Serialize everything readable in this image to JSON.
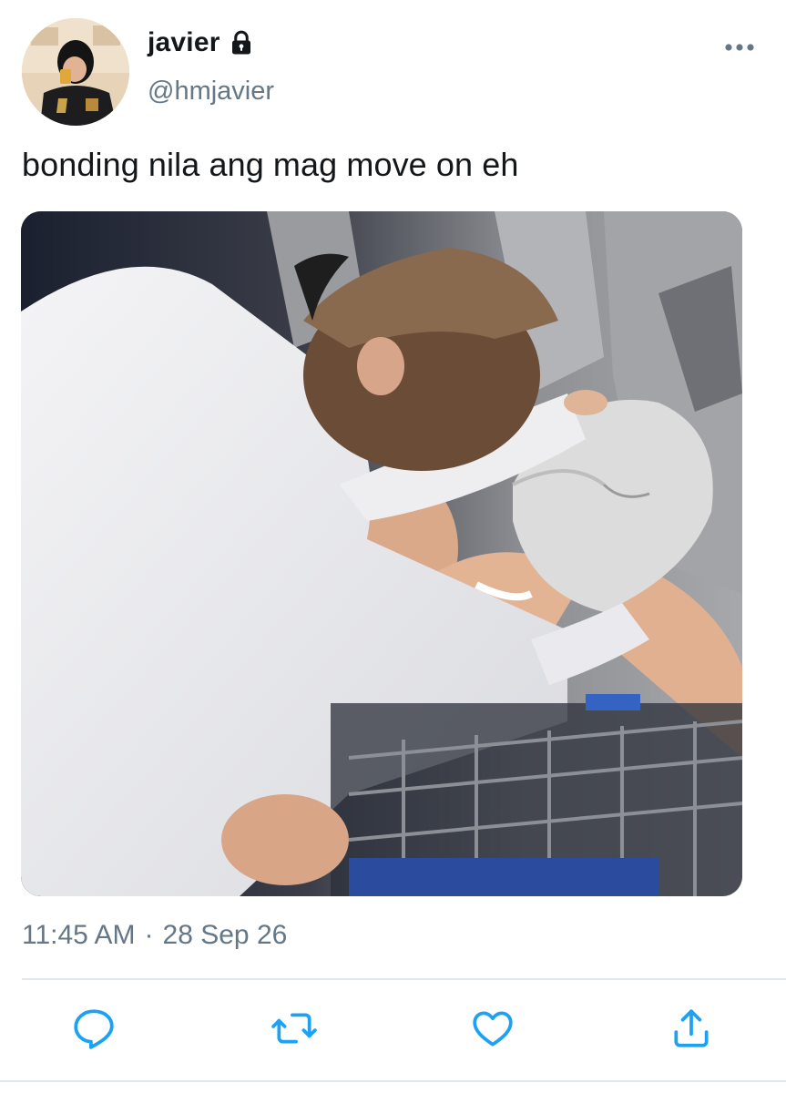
{
  "tweet": {
    "display_name": "javier",
    "handle": "@hmjavier",
    "protected_icon": "lock-icon",
    "more_icon": "more-horizontal-icon",
    "text": "bonding nila ang mag move on eh",
    "media": {
      "kind": "photo",
      "count": 1
    },
    "time": "11:45 AM",
    "separator": "·",
    "date": "28 Sep 26"
  },
  "actions": [
    {
      "name": "reply",
      "icon": "reply-icon"
    },
    {
      "name": "retweet",
      "icon": "retweet-icon"
    },
    {
      "name": "like",
      "icon": "heart-icon"
    },
    {
      "name": "share",
      "icon": "share-icon"
    }
  ],
  "colors": {
    "text_primary": "#14171a",
    "text_secondary": "#657786",
    "icon": "#1da1f2",
    "divider": "#e1e8ed",
    "background": "#ffffff"
  }
}
